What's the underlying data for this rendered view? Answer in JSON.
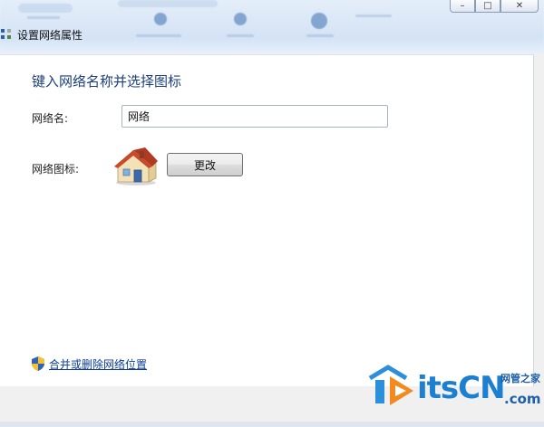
{
  "window": {
    "title": "设置网络属性",
    "controls": {
      "minimize": "–",
      "maximize": "□",
      "close": "✕"
    }
  },
  "form": {
    "heading": "键入网络名称并选择图标",
    "name_label": "网络名:",
    "name_value": "网络",
    "icon_label": "网络图标:",
    "icon": "house-network-icon",
    "change_button": "更改"
  },
  "footer": {
    "merge_link": "合并或删除网络位置",
    "shield_icon": "uac-shield-icon"
  },
  "watermark": {
    "brand": "itsCN",
    "line1": "网管之家",
    "line2": ".com"
  },
  "colors": {
    "heading": "#1d3f7a",
    "link": "#0b3c9c",
    "watermark": "#1d7fd0"
  }
}
